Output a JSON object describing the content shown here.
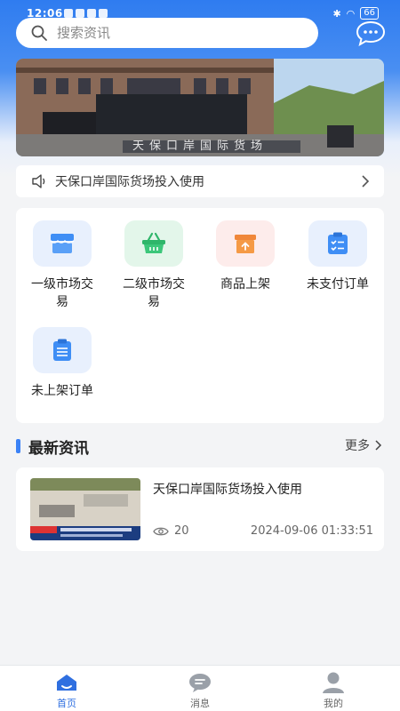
{
  "status_bar": {
    "time": "12:06",
    "battery": "66"
  },
  "search": {
    "placeholder": "搜索资讯"
  },
  "banner": {
    "caption": "天保口岸国际货场"
  },
  "notice": {
    "text": "天保口岸国际货场投入使用"
  },
  "grid": {
    "items": [
      {
        "label": "一级市场交易",
        "icon": "store-icon",
        "tile_color": "#e8f0fd"
      },
      {
        "label": "二级市场交易",
        "icon": "basket-icon",
        "tile_color": "#e3f6ea"
      },
      {
        "label": "商品上架",
        "icon": "box-upload-icon",
        "tile_color": "#fdeceb"
      },
      {
        "label": "未支付订单",
        "icon": "clipboard-check-icon",
        "tile_color": "#e8f0fd"
      },
      {
        "label": "未上架订单",
        "icon": "clipboard-list-icon",
        "tile_color": "#e8f0fd"
      }
    ]
  },
  "section": {
    "title": "最新资讯",
    "more": "更多"
  },
  "news": [
    {
      "title": "天保口岸国际货场投入使用",
      "views": "20",
      "date": "2024-09-06 01:33:51"
    }
  ],
  "tabbar": {
    "items": [
      {
        "label": "首页",
        "icon": "home-icon",
        "active": true
      },
      {
        "label": "消息",
        "icon": "message-icon",
        "active": false
      },
      {
        "label": "我的",
        "icon": "user-icon",
        "active": false
      }
    ]
  },
  "colors": {
    "accent": "#2f6fe0",
    "header_blue": "#2f7cf0"
  }
}
